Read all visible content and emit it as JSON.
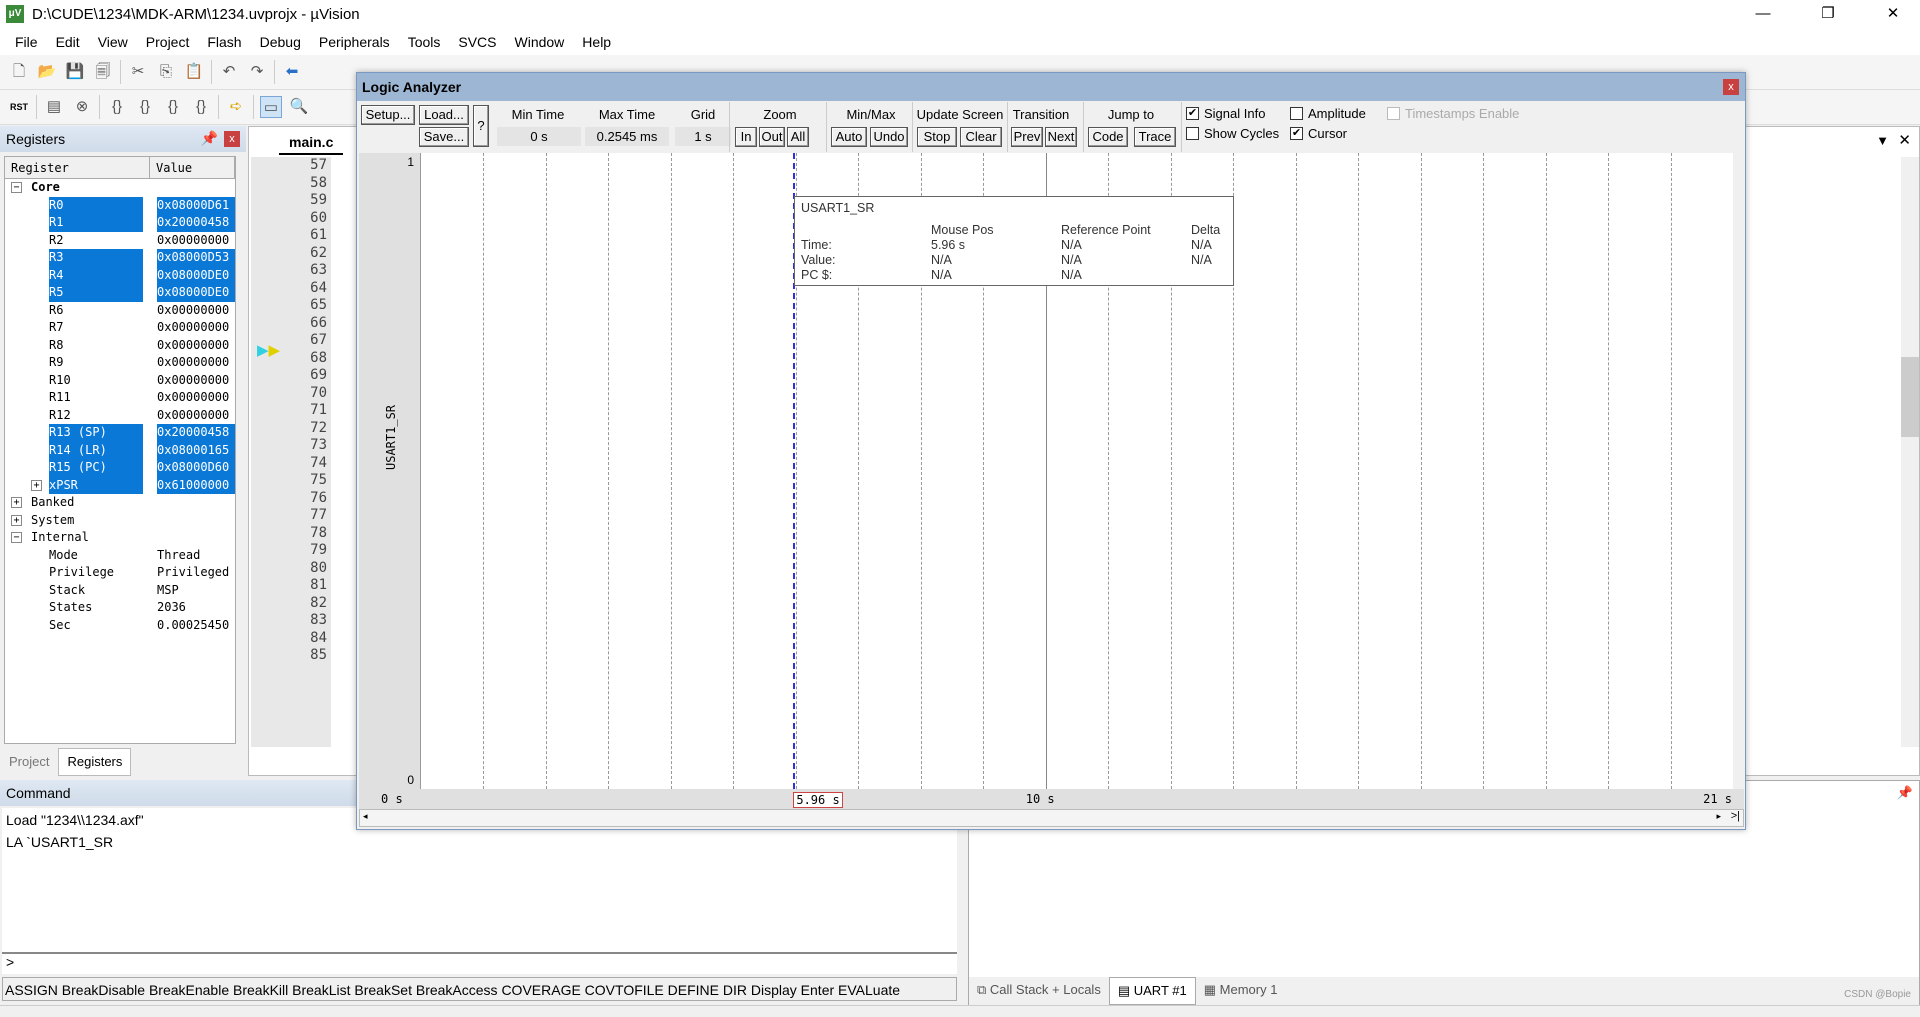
{
  "window": {
    "title": "D:\\CUDE\\1234\\MDK-ARM\\1234.uvprojx - µVision",
    "minimize": "—",
    "maximize": "❐",
    "close": "✕"
  },
  "menu": [
    "File",
    "Edit",
    "View",
    "Project",
    "Flash",
    "Debug",
    "Peripherals",
    "Tools",
    "SVCS",
    "Window",
    "Help"
  ],
  "toolbar2": {
    "rst_label": "RST"
  },
  "registers": {
    "title": "Registers",
    "col_register": "Register",
    "col_value": "Value",
    "rows": [
      {
        "name": "Core",
        "value": "",
        "level": 0,
        "expander": "−",
        "sel": false,
        "bold": true
      },
      {
        "name": "R0",
        "value": "0x08000D61",
        "level": 1,
        "sel": true
      },
      {
        "name": "R1",
        "value": "0x20000458",
        "level": 1,
        "sel": true
      },
      {
        "name": "R2",
        "value": "0x00000000",
        "level": 1,
        "sel": false
      },
      {
        "name": "R3",
        "value": "0x08000D53",
        "level": 1,
        "sel": true
      },
      {
        "name": "R4",
        "value": "0x08000DE0",
        "level": 1,
        "sel": true
      },
      {
        "name": "R5",
        "value": "0x08000DE0",
        "level": 1,
        "sel": true
      },
      {
        "name": "R6",
        "value": "0x00000000",
        "level": 1,
        "sel": false
      },
      {
        "name": "R7",
        "value": "0x00000000",
        "level": 1,
        "sel": false
      },
      {
        "name": "R8",
        "value": "0x00000000",
        "level": 1,
        "sel": false
      },
      {
        "name": "R9",
        "value": "0x00000000",
        "level": 1,
        "sel": false
      },
      {
        "name": "R10",
        "value": "0x00000000",
        "level": 1,
        "sel": false
      },
      {
        "name": "R11",
        "value": "0x00000000",
        "level": 1,
        "sel": false
      },
      {
        "name": "R12",
        "value": "0x00000000",
        "level": 1,
        "sel": false
      },
      {
        "name": "R13 (SP)",
        "value": "0x20000458",
        "level": 1,
        "sel": true
      },
      {
        "name": "R14 (LR)",
        "value": "0x08000165",
        "level": 1,
        "sel": true
      },
      {
        "name": "R15 (PC)",
        "value": "0x08000D60",
        "level": 1,
        "sel": true
      },
      {
        "name": "xPSR",
        "value": "0x61000000",
        "level": 1,
        "expander": "+",
        "sel": true
      },
      {
        "name": "Banked",
        "value": "",
        "level": 0,
        "expander": "+",
        "sel": false
      },
      {
        "name": "System",
        "value": "",
        "level": 0,
        "expander": "+",
        "sel": false
      },
      {
        "name": "Internal",
        "value": "",
        "level": 0,
        "expander": "−",
        "sel": false
      },
      {
        "name": "Mode",
        "value": "Thread",
        "level": 1,
        "sel": false
      },
      {
        "name": "Privilege",
        "value": "Privileged",
        "level": 1,
        "sel": false
      },
      {
        "name": "Stack",
        "value": "MSP",
        "level": 1,
        "sel": false
      },
      {
        "name": "States",
        "value": "2036",
        "level": 1,
        "sel": false
      },
      {
        "name": "Sec",
        "value": "0.00025450",
        "level": 1,
        "sel": false
      }
    ],
    "tabs": [
      "Project",
      "Registers"
    ]
  },
  "editor": {
    "tab": "main.c",
    "lines": [
      "57",
      "58",
      "59",
      "60",
      "61",
      "62",
      "63",
      "64",
      "65",
      "66",
      "67",
      "68",
      "69",
      "70",
      "71",
      "72",
      "73",
      "74",
      "75",
      "76",
      "77",
      "78",
      "79",
      "80",
      "81",
      "82",
      "83",
      "84",
      "85"
    ]
  },
  "logic_analyzer": {
    "title": "Logic Analyzer",
    "setup": "Setup...",
    "load": "Load...",
    "save": "Save...",
    "help": "?",
    "min_time_label": "Min Time",
    "min_time": "0 s",
    "max_time_label": "Max Time",
    "max_time": "0.2545 ms",
    "grid_label": "Grid",
    "grid": "1 s",
    "zoom_label": "Zoom",
    "zoom_in": "In",
    "zoom_out": "Out",
    "zoom_all": "All",
    "minmax_label": "Min/Max",
    "auto": "Auto",
    "undo": "Undo",
    "update_label": "Update Screen",
    "stop": "Stop",
    "clear": "Clear",
    "transition_label": "Transition",
    "prev": "Prev",
    "next": "Next",
    "jump_label": "Jump to",
    "code": "Code",
    "trace": "Trace",
    "options": [
      {
        "label": "Signal Info",
        "checked": true
      },
      {
        "label": "Amplitude",
        "checked": false
      },
      {
        "label": "Timestamps Enable",
        "checked": false,
        "disabled": true
      },
      {
        "label": "Show Cycles",
        "checked": false
      },
      {
        "label": "Cursor",
        "checked": true
      }
    ],
    "signal": "USART1_SR",
    "y_max": "1",
    "y_min": "0",
    "axis": {
      "start": "0 s",
      "mid": "10 s",
      "end": "21 s",
      "cursor": "5.96 s",
      "range_s": [
        0,
        21
      ],
      "grid_s": 1,
      "cursor_s": 5.96
    },
    "tooltip": {
      "title": "USART1_SR",
      "headers": [
        "",
        "Mouse Pos",
        "Reference Point",
        "Delta"
      ],
      "rows": [
        [
          "Time:",
          "5.96 s",
          "N/A",
          "N/A"
        ],
        [
          "Value:",
          "N/A",
          "N/A",
          "N/A"
        ],
        [
          "PC $:",
          "N/A",
          "N/A",
          ""
        ]
      ]
    },
    "colors": {
      "cursor": "#3030e0",
      "titlebar": "#9db6d3"
    }
  },
  "command": {
    "title": "Command",
    "output": [
      "Load \"1234\\\\1234.axf\"",
      "LA `USART1_SR"
    ],
    "prompt": ">",
    "help": "ASSIGN BreakDisable BreakEnable BreakKill BreakList BreakSet BreakAccess COVERAGE COVTOFILE DEFINE DIR Display Enter EVALuate"
  },
  "bottom_tabs": [
    "Call Stack + Locals",
    "UART #1",
    "Memory 1"
  ],
  "watermark": "CSDN @Bopie"
}
